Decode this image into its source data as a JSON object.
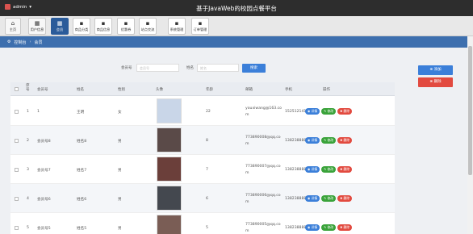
{
  "header": {
    "user": "admin",
    "title": "基于JavaWeb的校园点餐平台"
  },
  "toolbar": [
    {
      "label": "主页",
      "glyph": "⌂"
    },
    {
      "label": "用户信息",
      "glyph": "▦"
    },
    {
      "label": "会员",
      "glyph": "▦"
    },
    {
      "label": "商品分类",
      "glyph": "▪"
    },
    {
      "label": "商品信息",
      "glyph": "▪"
    },
    {
      "label": "优惠券",
      "glyph": "▪"
    },
    {
      "label": "站点交流",
      "glyph": "▪"
    },
    {
      "label": "系统管理",
      "glyph": "▪"
    },
    {
      "label": "订单管理",
      "glyph": "▪"
    }
  ],
  "breadcrumb": {
    "home": "控制台",
    "current": "会员"
  },
  "search": {
    "account_label": "会员号",
    "account_placeholder": "会员号",
    "name_label": "姓名",
    "name_placeholder": "姓名",
    "button": "搜索"
  },
  "actions": {
    "add": "⊕ 添加",
    "delete": "⊗ 删除"
  },
  "table": {
    "headers": [
      "序号",
      "会员号",
      "姓名",
      "性别",
      "头像",
      "年龄",
      "邮箱",
      "手机",
      "操作"
    ],
    "rows": [
      {
        "no": "1",
        "account": "1",
        "name": "王明",
        "gender": "女",
        "age": "22",
        "email": "youxiwang@163.com",
        "phone": "15251214121",
        "avatar": "#c9d6e8"
      },
      {
        "no": "2",
        "account": "会员号8",
        "name": "姓名8",
        "gender": "男",
        "age": "8",
        "email": "773890008@qq.com",
        "phone": "13823888888",
        "avatar": "#5a4a48"
      },
      {
        "no": "3",
        "account": "会员号7",
        "name": "姓名7",
        "gender": "男",
        "age": "7",
        "email": "773890007@qq.com",
        "phone": "13823888887",
        "avatar": "#6b3f3a"
      },
      {
        "no": "4",
        "account": "会员号6",
        "name": "姓名6",
        "gender": "男",
        "age": "6",
        "email": "773890006@qq.com",
        "phone": "13823888886",
        "avatar": "#44484f"
      },
      {
        "no": "5",
        "account": "会员号5",
        "name": "姓名5",
        "gender": "男",
        "age": "5",
        "email": "773890005@qq.com",
        "phone": "13823888885",
        "avatar": "#7a5d55"
      }
    ],
    "ops": {
      "view": "◉ 详情",
      "edit": "✎ 修改",
      "del": "✖ 删除"
    }
  }
}
